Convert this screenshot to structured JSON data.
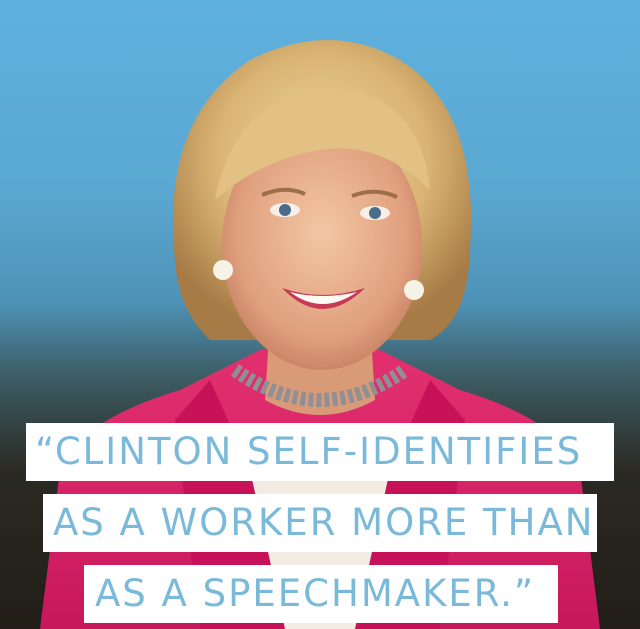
{
  "quote": {
    "lines": [
      "“CLINTON SELF-IDENTIFIES",
      "AS A WORKER MORE THAN",
      "AS A SPEECHMAKER.”"
    ]
  },
  "colors": {
    "banner_background": "#ffffff",
    "quote_text": "#7ab9d9",
    "sky_blue": "#5fb1de",
    "jacket_pink": "#d81f6a"
  }
}
